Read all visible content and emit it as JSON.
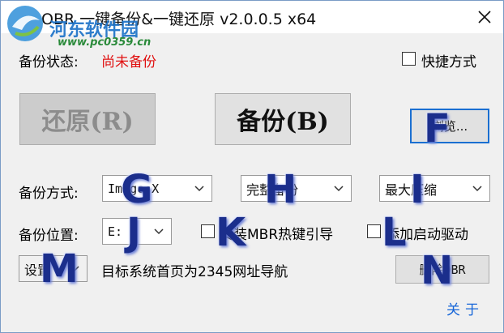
{
  "window": {
    "title": "OBR 一键备份&一键还原 v2.0.0.5 x64"
  },
  "watermark": {
    "site_name": "河东软件园",
    "url": "www.pc0359.cn"
  },
  "status": {
    "label": "备份状态:",
    "value": "尚未备份",
    "value_color": "#e01010"
  },
  "shortcut": {
    "label": "快捷方式",
    "checked": false
  },
  "buttons": {
    "restore": "还原(R)",
    "backup": "备份(B)",
    "browse": "浏览...",
    "delete_obr": "删除OBR"
  },
  "backup_mode": {
    "label": "备份方式:",
    "image_select": "Image:X",
    "type_select": "完整备份",
    "compress_select": "最大压缩"
  },
  "backup_location": {
    "label": "备份位置:",
    "drive_select": "E:"
  },
  "options": {
    "install_hotkey": "安装MBR热键引导",
    "add_boot_driver": "添加启动驱动"
  },
  "settings": {
    "select": "设置",
    "homepage_note": "目标系统首页为2345网址导航"
  },
  "about": "关于",
  "overlay_letters": [
    "F",
    "G",
    "H",
    "I",
    "J",
    "K",
    "L",
    "M",
    "N"
  ],
  "colors": {
    "accent": "#1a6fd1",
    "link": "#1565d8",
    "overlay": "#1b2e8c"
  }
}
